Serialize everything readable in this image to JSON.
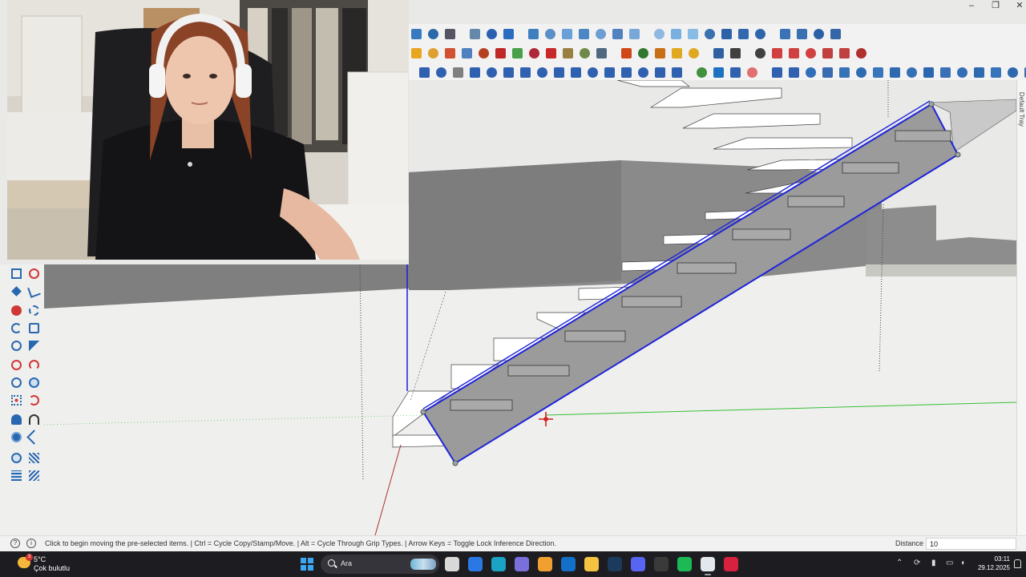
{
  "window": {
    "min": "–",
    "max": "❐",
    "close": "✕"
  },
  "tray": {
    "label": "Default Tray"
  },
  "status": {
    "message": "Click to begin moving the pre-selected items. | Ctrl = Cycle Copy/Stamp/Move. | Alt = Cycle Through Grip Types. | Arrow Keys = Toggle Lock Inference Direction.",
    "vcb_label": "Distance",
    "vcb_value": "10"
  },
  "colors": {
    "selection": "#1f24d8",
    "green_axis": "#38c038",
    "red_axis": "#b03030",
    "blue_axis": "#1a1ae0",
    "step_fill": "#ffffff",
    "stringer_fill": "#9b9b9b",
    "taskbar": "#1d1d21"
  },
  "taskbar": {
    "weather_temp": "5°C",
    "weather_text": "Çok bulutlu",
    "weather_badge": "3",
    "search_label": "Ara",
    "time": "03:11",
    "date": "29.12.2025",
    "apps": [
      {
        "name": "file-explorer-icon",
        "color": "#d8d8d8"
      },
      {
        "name": "store-icon",
        "color": "#2b78e4"
      },
      {
        "name": "edge-icon",
        "color": "#1aa3c5"
      },
      {
        "name": "teams-icon",
        "color": "#7b6fdc"
      },
      {
        "name": "copilot-icon",
        "color": "#f0a030"
      },
      {
        "name": "outlook-icon",
        "color": "#1370c8"
      },
      {
        "name": "folder-icon",
        "color": "#f5c242"
      },
      {
        "name": "steam-icon",
        "color": "#1b3a5c"
      },
      {
        "name": "discord-icon",
        "color": "#5865f2"
      },
      {
        "name": "obs-icon",
        "color": "#3a3a3a"
      },
      {
        "name": "spotify-icon",
        "color": "#1db954"
      },
      {
        "name": "sketchup-icon",
        "color": "#e2e8ee"
      },
      {
        "name": "acrobat-icon",
        "color": "#d8203f"
      }
    ]
  },
  "toolbar_icons": {
    "row1": [
      "#3a7bbf",
      "#2a6aa8",
      "#556",
      "#6688aa",
      "#2b5fb0",
      "#2b6bc0",
      "#3f7fbf",
      "#5a8fc8",
      "#6aa0d8",
      "#4d86c4",
      "#6c9ed4",
      "#5082c0",
      "#78a8d8",
      "#8fb8e0",
      "#7ab0e0",
      "#88bbe6",
      "#3a70b0",
      "#2d62a8",
      "#3468ae",
      "#2e65ab",
      "#3b72b5",
      "#3a6fb0",
      "#2c60a6",
      "#3566a8"
    ],
    "row2": [
      "#e8a520",
      "#e0a030",
      "#d05030",
      "#5080c0",
      "#b44020",
      "#c02828",
      "#48a048",
      "#b02838",
      "#c82828",
      "#9a8040",
      "#708848",
      "#506880",
      "#d04818",
      "#307830",
      "#c87018",
      "#e0a820",
      "#e0a820",
      "#3060a0",
      "#404040",
      "#404040",
      "#d04040",
      "#d04040",
      "#d04040",
      "#c04040",
      "#c04040",
      "#b03030"
    ],
    "row3": [
      "#3060b0",
      "#3060b0",
      "#808080",
      "#3060b0",
      "#3060b0",
      "#3060b0",
      "#3060b0",
      "#3060b0",
      "#3060b0",
      "#3060b0",
      "#3060b0",
      "#3060b0",
      "#3060b0",
      "#3060b0",
      "#3060b0",
      "#3060b0",
      "#409040",
      "#2070c0",
      "#3060b0",
      "#e07070",
      "#3060b0",
      "#3060b0",
      "#2f6fb8",
      "#3a6bb0",
      "#3672b6",
      "#2d6bb3",
      "#3a74bb",
      "#3169b0",
      "#3570b5",
      "#2c66ae",
      "#3a70b5",
      "#346fb5",
      "#2f6ab0",
      "#3774ba",
      "#2e68ae",
      "#3a70b5",
      "#3470b6"
    ]
  }
}
